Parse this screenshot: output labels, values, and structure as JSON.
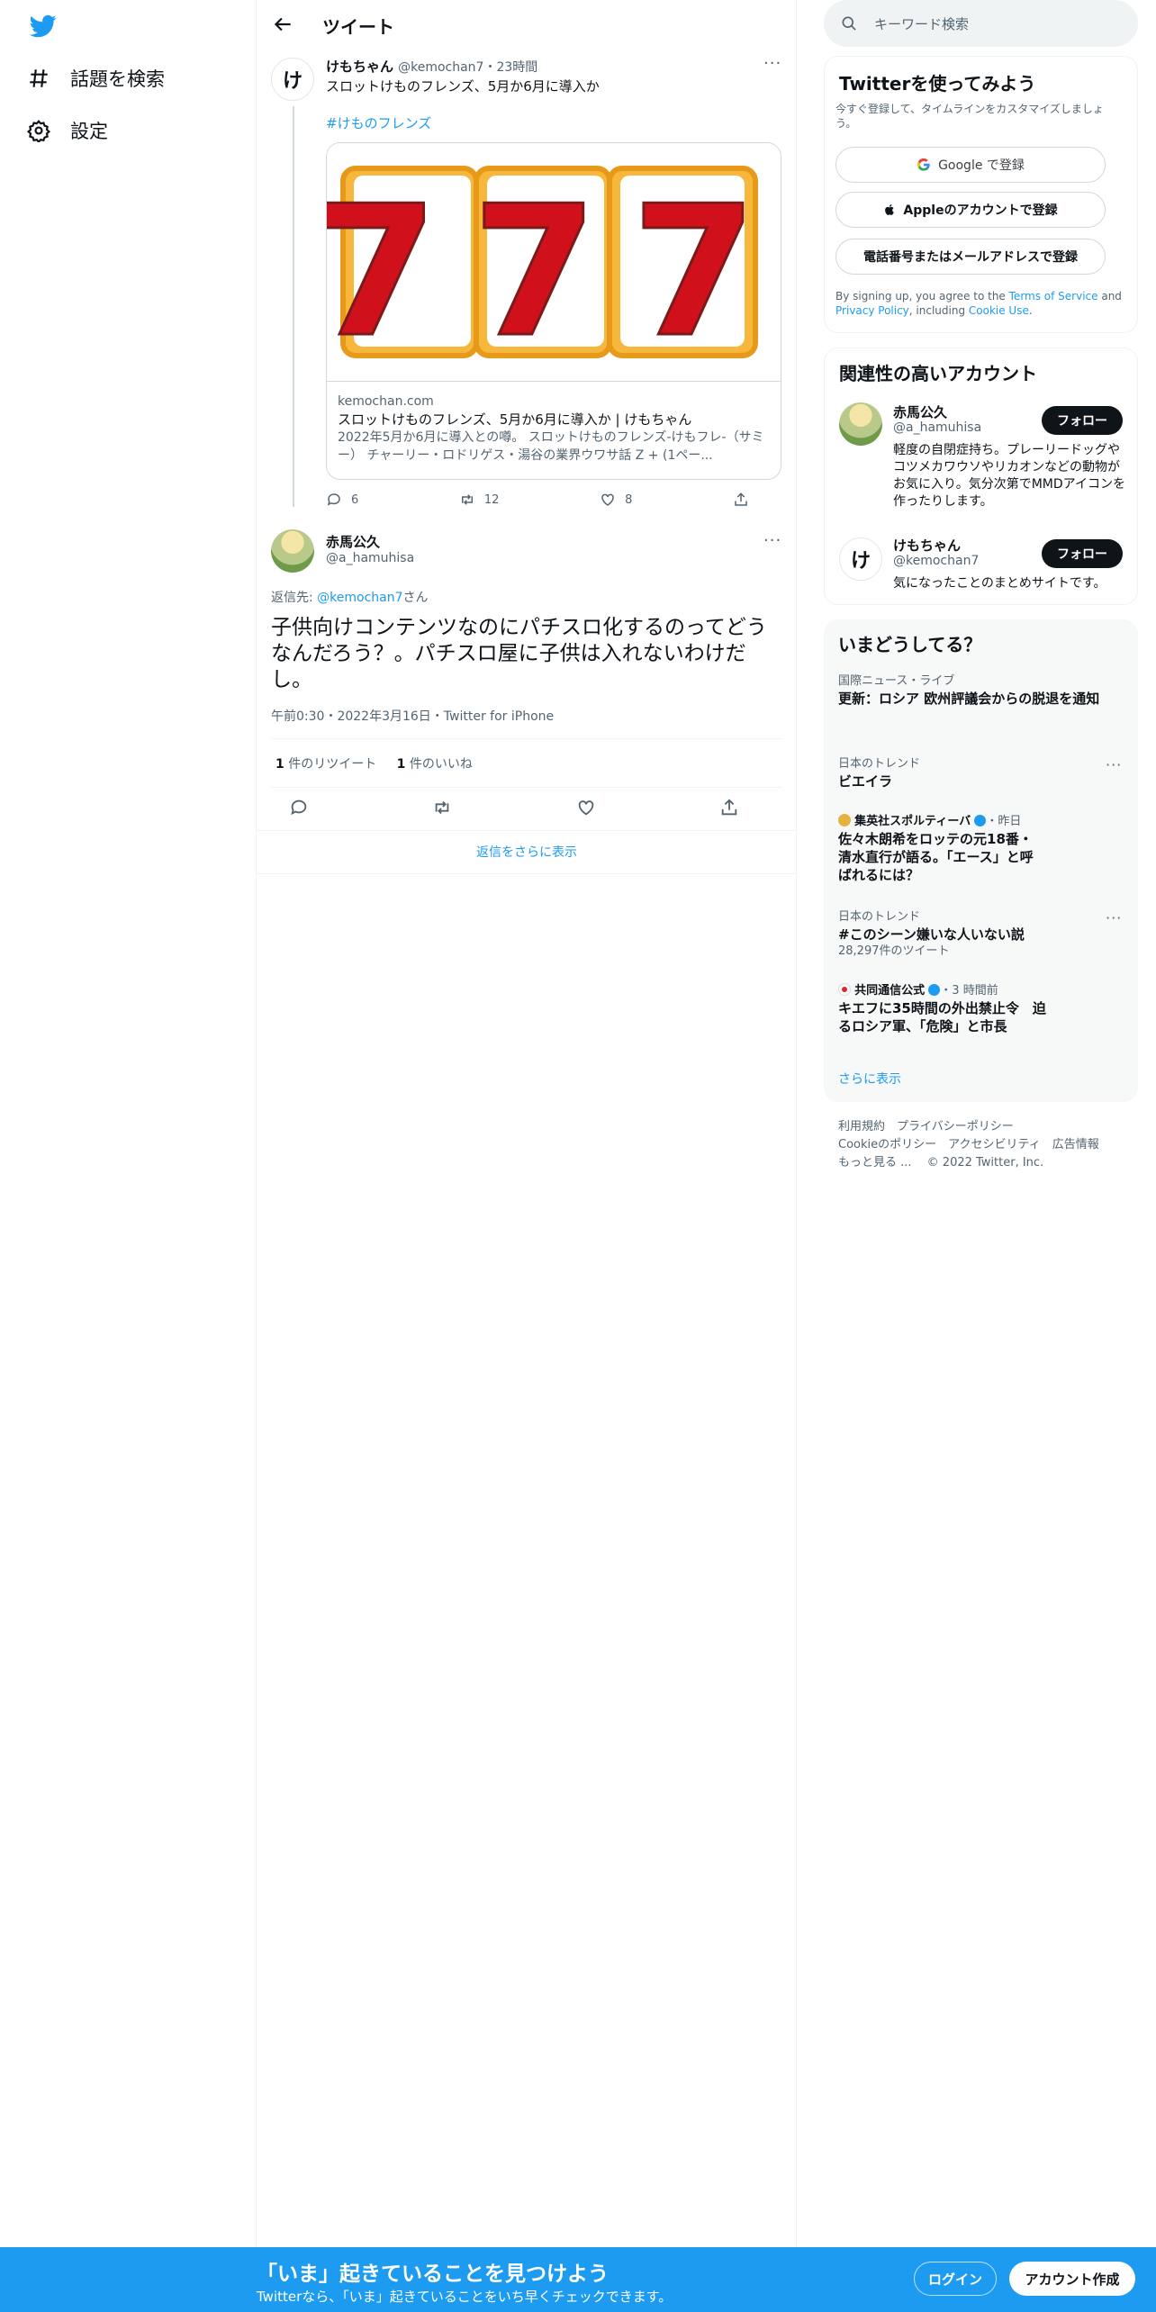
{
  "nav": {
    "explore_label": "話題を検索",
    "settings_label": "設定"
  },
  "header": {
    "title": "ツイート"
  },
  "parent_tweet": {
    "avatar_text": "け",
    "name": "けもちゃん",
    "handle": "@kemochan7",
    "time": "23時間",
    "text": "スロットけものフレンズ、5月か6月に導入か",
    "hashtag": "#けものフレンズ",
    "card": {
      "domain": "kemochan.com",
      "title": "スロットけものフレンズ、5月か6月に導入か | けもちゃん",
      "description": "2022年5月か6月に導入との噂。 スロットけものフレンズ-けもフレ-（サミー） チャーリー・ロドリゲス・湯谷の業界ウワサ話 Z + (1ペー...",
      "image_text": "777"
    },
    "replies": "6",
    "retweets": "12",
    "likes": "8"
  },
  "main_tweet": {
    "name": "赤馬公久",
    "handle": "@a_hamuhisa",
    "reply_prefix": "返信先: ",
    "reply_to": "@kemochan7",
    "reply_suffix": "さん",
    "text": "子供向けコンテンツなのにパチスロ化するのってどうなんだろう？。パチスロ屋に子供は入れないわけだし。",
    "timestamp": "午前0:30・2022年3月16日・Twitter for iPhone",
    "retweet_count": "1",
    "retweet_label": " 件のリツイート",
    "like_count": "1",
    "like_label": " 件のいいね",
    "show_more": "返信をさらに表示"
  },
  "search": {
    "placeholder": "キーワード検索"
  },
  "signup_panel": {
    "title": "Twitterを使ってみよう",
    "subtitle": "今すぐ登録して、タイムラインをカスタマイズしましょう。",
    "google": "Google で登録",
    "apple": "Appleのアカウントで登録",
    "phone": "電話番号またはメールアドレスで登録",
    "legal_1": "By signing up, you agree to the ",
    "terms": "Terms of Service",
    "legal_2": " and ",
    "privacy": "Privacy Policy",
    "legal_3": ", including ",
    "cookie": "Cookie Use",
    "legal_4": "."
  },
  "related": {
    "title": "関連性の高いアカウント",
    "accounts": [
      {
        "name": "赤馬公久",
        "handle": "@a_hamuhisa",
        "bio": "軽度の自閉症持ち。プレーリードッグやコツメカワウソやリカオンなどの動物がお気に入り。気分次第でMMDアイコンを作ったりします。",
        "follow": "フォロー"
      },
      {
        "name": "けもちゃん",
        "handle": "@kemochan7",
        "bio": "気になったことのまとめサイトです。",
        "follow": "フォロー",
        "avatar_text": "け"
      }
    ]
  },
  "trends": {
    "title": "いまどうしてる？",
    "items": [
      {
        "meta": "国際ニュース・ライブ",
        "title": "更新：ロシア 欧州評議会からの脱退を通知"
      },
      {
        "meta": "日本のトレンド",
        "title": "ビエイラ"
      },
      {
        "source": "集英社スポルティーバ",
        "time": "・昨日",
        "title": "佐々木朗希をロッテの元18番・清水直行が語る。「エース」と呼ばれるには？"
      },
      {
        "meta": "日本のトレンド",
        "title": "#このシーン嫌いな人いない説",
        "count": "28,297件のツイート"
      },
      {
        "source": "共同通信公式",
        "time": "・3 時間前",
        "title": "キエフに35時間の外出禁止令　迫るロシア軍、「危険」と市長"
      }
    ],
    "show_more": "さらに表示"
  },
  "footer": {
    "line1": "利用規約　プライバシーポリシー",
    "line2": "Cookieのポリシー　アクセシビリティ　広告情報",
    "line3": "もっと見る ...　 © 2022 Twitter, Inc."
  },
  "banner": {
    "title": "「いま」起きていることを見つけよう",
    "subtitle": "Twitterなら、「いま」起きていることをいち早くチェックできます。",
    "login": "ログイン",
    "signup": "アカウント作成"
  },
  "colors": {
    "brand": "#1d9bf0",
    "text": "#0f1419",
    "muted": "#536471"
  }
}
